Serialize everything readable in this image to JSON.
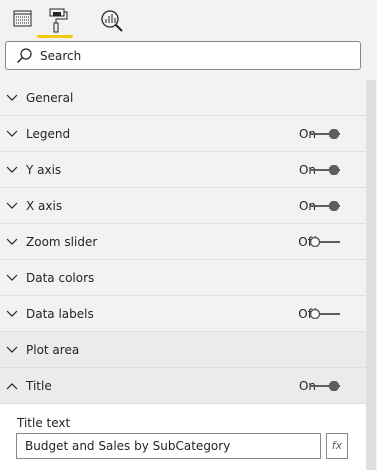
{
  "tabs": [
    {
      "icon": "fields-grid-icon",
      "active": false
    },
    {
      "icon": "paint-roller-icon",
      "active": true
    },
    {
      "icon": "analytics-magnifier-icon",
      "active": false
    }
  ],
  "search": {
    "placeholder": "Search"
  },
  "sections": [
    {
      "label": "General",
      "expanded": false
    },
    {
      "label": "Legend",
      "toggle": "On",
      "expanded": false
    },
    {
      "label": "Y axis",
      "toggle": "On",
      "expanded": false
    },
    {
      "label": "X axis",
      "toggle": "On",
      "expanded": false
    },
    {
      "label": "Zoom slider",
      "toggle": "Off",
      "expanded": false
    },
    {
      "label": "Data colors",
      "expanded": false
    },
    {
      "label": "Data labels",
      "toggle": "Off",
      "expanded": false
    },
    {
      "label": "Plot area",
      "expanded": false
    },
    {
      "label": "Title",
      "toggle": "On",
      "expanded": true
    }
  ],
  "title": {
    "text_label": "Title text",
    "text_value": "Budget and Sales by SubCategory",
    "fx_label": "fx"
  },
  "colors": {
    "accent": "#f2c811",
    "toggle": "#605e5c"
  }
}
